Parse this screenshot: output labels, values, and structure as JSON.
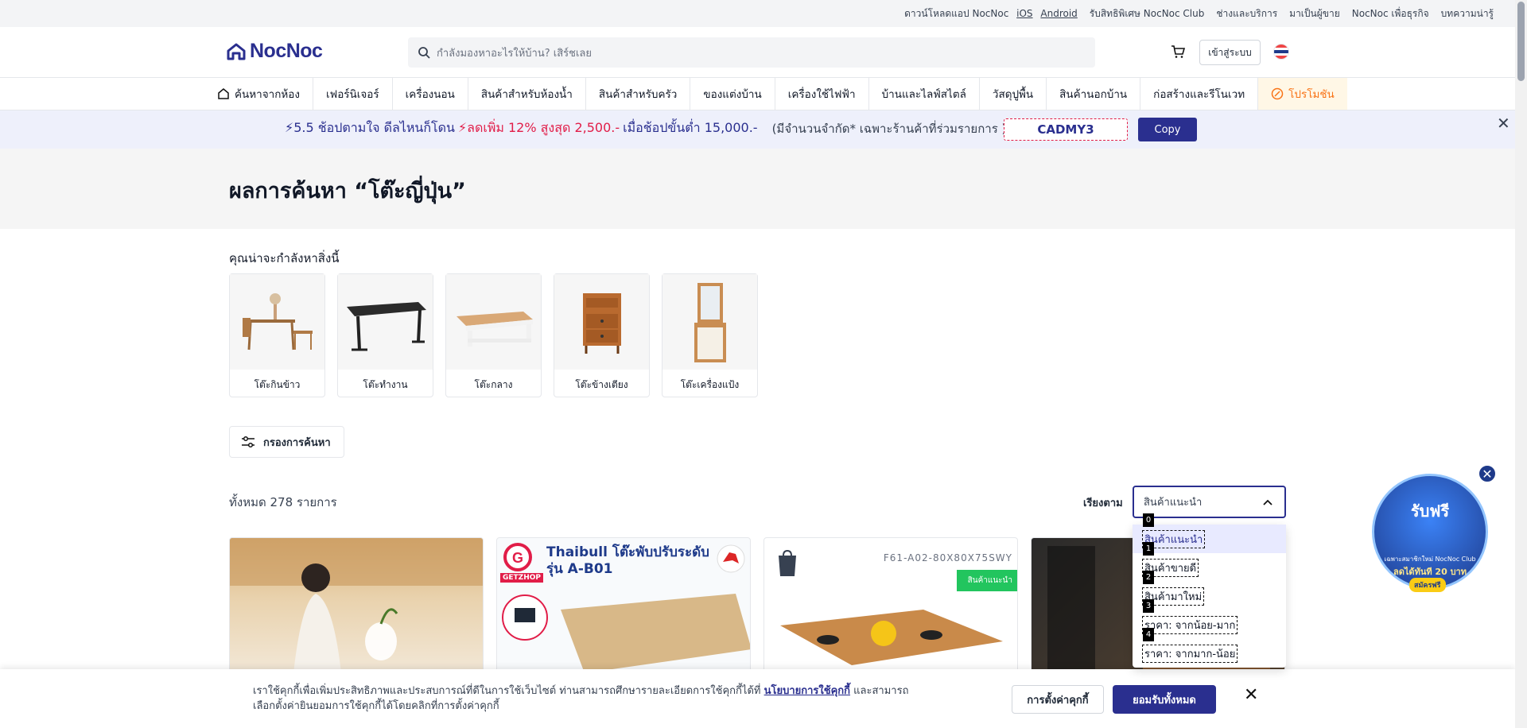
{
  "topbar": {
    "download_text": "ดาวน์โหลดแอป NocNoc",
    "ios": "iOS",
    "android": "Android",
    "club": "รับสิทธิพิเศษ NocNoc Club",
    "services": "ช่างและบริการ",
    "seller": "มาเป็นผู้ขาย",
    "business": "NocNoc เพื่อธุรกิจ",
    "articles": "บทความน่ารู้"
  },
  "header": {
    "logo_text": "NocNoc",
    "search_placeholder": "กำลังมองหาอะไรให้บ้าน? เสิร์ชเลย",
    "login_label": "เข้าสู่ระบบ"
  },
  "nav": {
    "items": [
      "ค้นหาจากห้อง",
      "เฟอร์นิเจอร์",
      "เครื่องนอน",
      "สินค้าสำหรับห้องน้ำ",
      "สินค้าสำหรับครัว",
      "ของแต่งบ้าน",
      "เครื่องใช้ไฟฟ้า",
      "บ้านและไลฟ์สไตล์",
      "วัสดุปูพื้น",
      "สินค้านอกบ้าน",
      "ก่อสร้างและรีโนเวท",
      "โปรโมชัน"
    ]
  },
  "banner": {
    "part1": "⚡5.5 ช้อปตามใจ ดีลไหนก็โดน",
    "part2": "⚡ลดเพิ่ม 12% สูงสุด 2,500.-",
    "part3": "เมื่อช้อปขั้นต่ำ 15,000.-",
    "note": "(มีจำนวนจำกัด* เฉพาะร้านค้าที่ร่วมรายการ )",
    "code": "CADMY3",
    "copy_label": "Copy"
  },
  "results": {
    "title": "ผลการค้นหา “โต๊ะญี่ปุ่น”",
    "suggest_label": "คุณน่าจะกำลังหาสิ่งนี้",
    "categories": [
      "โต๊ะกินข้าว",
      "โต๊ะทำงาน",
      "โต๊ะกลาง",
      "โต๊ะข้างเตียง",
      "โต๊ะเครื่องแป้ง"
    ],
    "filter_label": "กรองการค้นหา",
    "total": "ทั้งหมด 278 รายการ",
    "sort_label": "เรียงตาม",
    "sort_value": "สินค้าแนะนำ",
    "sort_options": [
      "สินค้าแนะนำ",
      "สินค้าขายดี",
      "สินค้ามาใหม่",
      "ราคา: จากน้อย-มาก",
      "ราคา: จากมาก-น้อย"
    ],
    "sort_indexes": [
      "0",
      "1",
      "2",
      "3",
      "4"
    ]
  },
  "products": {
    "p2_title_line1": "Thaibull โต๊ะพับปรับระดับ",
    "p2_title_line2": "รุ่น A-B01",
    "p2_brand": "GETZHOP",
    "p3_code": "F61-A02-80X80X75SWY",
    "p3_tag": "สินค้าแนะนำ"
  },
  "promo_badge": {
    "title": "รับฟรี",
    "sub": "เฉพาะสมาชิกใหม่ NocNoc Club",
    "big": "ลดได้ทันที 20 บาท",
    "cta": "สมัครฟรี"
  },
  "cookie": {
    "text1": "เราใช้คุกกี้เพื่อเพิ่มประสิทธิภาพและประสบการณ์ที่ดีในการใช้เว็บไซต์ ท่านสามารถศึกษารายละเอียดการใช้คุกกี้ได้ที่",
    "link": "นโยบายการใช้คุกกี้",
    "text2": "และสามารถเลือกตั้งค่ายินยอมการใช้คุกกี้ได้โดยคลิกที่การตั้งค่าคุกกี้",
    "settings_label": "การตั้งค่าคุกกี้",
    "accept_label": "ยอมรับทั้งหมด"
  },
  "colors": {
    "brand": "#2a2f8f",
    "accent_red": "#e11d48",
    "promo_orange": "#f97316"
  }
}
